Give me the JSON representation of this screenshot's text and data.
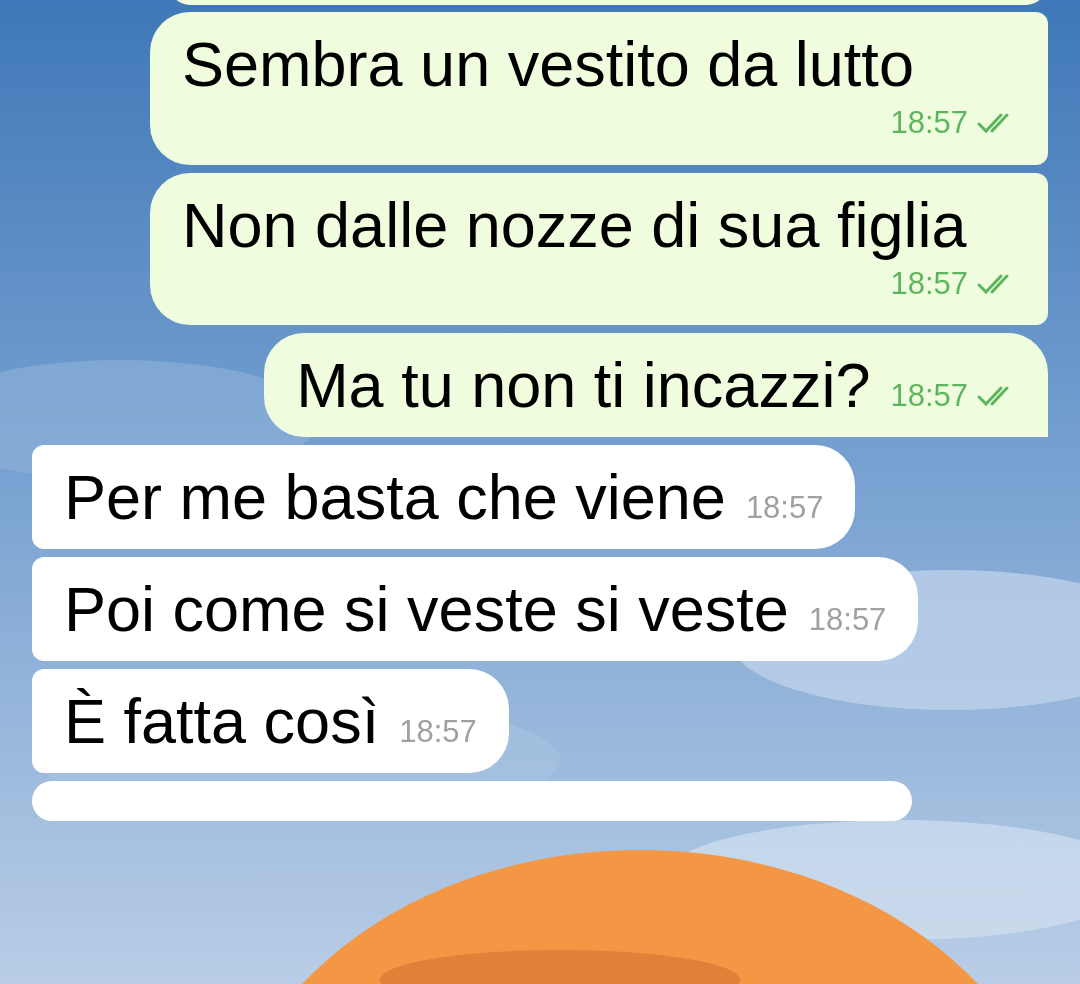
{
  "messages": [
    {
      "kind": "outgoing",
      "text": "Sembra un vestito da lutto",
      "time": "18:57",
      "read": true,
      "tail": false
    },
    {
      "kind": "outgoing",
      "text": "Non dalle nozze di sua figlia",
      "time": "18:57",
      "read": true,
      "tail": false
    },
    {
      "kind": "outgoing",
      "text": "Ma tu non ti incazzi?",
      "time": "18:57",
      "read": true,
      "tail": true
    },
    {
      "kind": "incoming",
      "text": "Per me basta che viene",
      "time": "18:57",
      "tail": false
    },
    {
      "kind": "incoming",
      "text": "Poi come si veste si veste",
      "time": "18:57",
      "tail": false
    },
    {
      "kind": "incoming",
      "text": "È fatta così",
      "time": "18:57",
      "tail": false
    }
  ]
}
